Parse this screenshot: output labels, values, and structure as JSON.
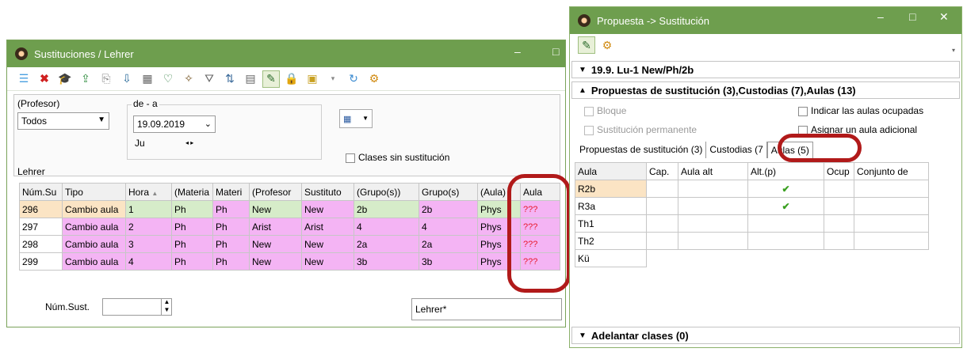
{
  "left_window": {
    "title": "Sustituciones / Lehrer",
    "filters": {
      "profesor_label": "(Profesor)",
      "profesor_value": "Todos",
      "range_label": "de - a",
      "date_value": "19.09.2019",
      "day_label": "Ju",
      "clases_label": "Clases sin sustitución",
      "section_label": "Lehrer"
    },
    "columns": [
      "Núm.Su",
      "Tipo",
      "Hora",
      "(Materia",
      "Materi",
      "(Profesor",
      "Sustituto",
      "(Grupo(s))",
      "Grupo(s)",
      "(Aula)",
      "Aula"
    ],
    "rows": [
      [
        "296",
        "Cambio aula",
        "1",
        "Ph",
        "Ph",
        "New",
        "New",
        "2b",
        "2b",
        "Phys",
        "???"
      ],
      [
        "297",
        "Cambio aula",
        "2",
        "Ph",
        "Ph",
        "Arist",
        "Arist",
        "4",
        "4",
        "Phys",
        "???"
      ],
      [
        "298",
        "Cambio aula",
        "3",
        "Ph",
        "Ph",
        "New",
        "New",
        "2a",
        "2a",
        "Phys",
        "???"
      ],
      [
        "299",
        "Cambio aula",
        "4",
        "Ph",
        "Ph",
        "New",
        "New",
        "3b",
        "3b",
        "Phys",
        "???"
      ]
    ],
    "num_sust_label": "Núm.Sust.",
    "view_value": "Lehrer*"
  },
  "right_window": {
    "title": "Propuesta -> Sustitución",
    "section1": "19.9. Lu-1 New/Ph/2b",
    "section2": "Propuestas de sustitución (3),Custodias (7),Aulas (13)",
    "options": {
      "bloque": "Bloque",
      "permanente": "Sustitución permanente",
      "indicar": "Indicar las aulas ocupadas",
      "asignar": "Asignar un aula adicional"
    },
    "tabs": [
      "Propuestas de sustitución (3)",
      "Custodias (7",
      "Aulas (5)"
    ],
    "columns": [
      "Aula",
      "Cap.",
      "Aula alt",
      "Alt.(p)",
      "Ocup",
      "Conjunto de"
    ],
    "rows": [
      {
        "aula": "R2b",
        "check": true
      },
      {
        "aula": "R3a",
        "check": true
      },
      {
        "aula": "Th1",
        "check": false
      },
      {
        "aula": "Th2",
        "check": false
      },
      {
        "aula": "Kü",
        "check": false
      }
    ],
    "section3": "Adelantar clases (0)"
  },
  "colors": {
    "titlebar": "#6e9e4e",
    "pink": "#f4b4f4",
    "green": "#d6ecc9",
    "ring": "#b11a1a"
  }
}
